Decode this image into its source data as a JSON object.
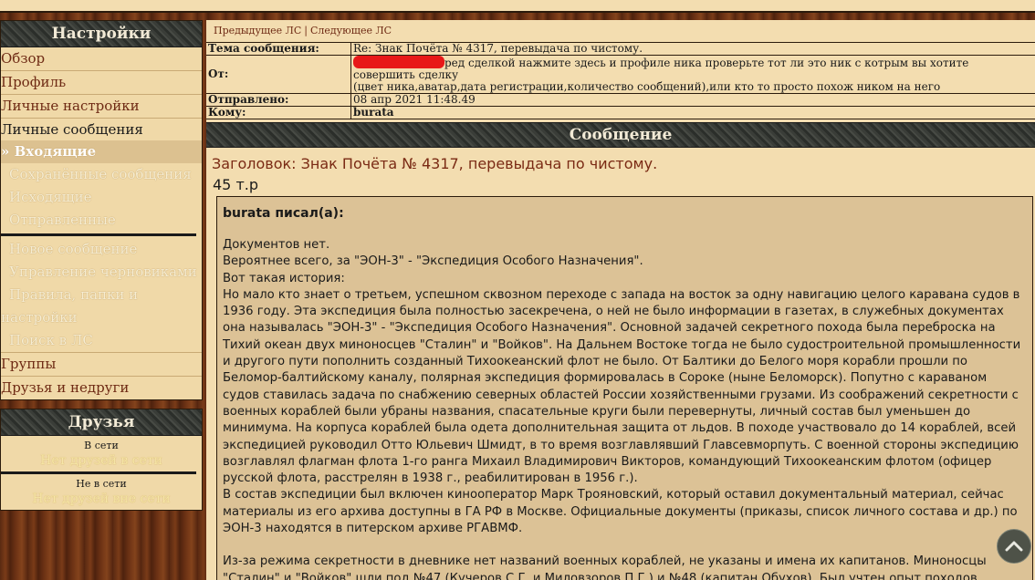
{
  "sidebar": {
    "settings_title": "Настройки",
    "top_items": [
      "Обзор",
      "Профиль",
      "Личные настройки"
    ],
    "pm_title": "Личные сообщения",
    "pm_items": [
      {
        "label": "» Входящие"
      },
      {
        "label": "Сохранённые сообщения"
      },
      {
        "label": "Исходящие"
      },
      {
        "label": "Отправленные"
      }
    ],
    "pm_items2": [
      {
        "label": "Новое сообщение"
      },
      {
        "label": "Управление черновиками"
      },
      {
        "label": "Правила, папки и"
      },
      {
        "label": "настройки"
      },
      {
        "label": "Поиск в ЛС"
      }
    ],
    "bottom_items": [
      "Группы",
      "Друзья и недруги"
    ],
    "friends_title": "Друзья",
    "online_label": "В сети",
    "online_empty": "Нет друзей в сети",
    "offline_label": "Не в сети",
    "offline_empty": "Нет друзей вне сети"
  },
  "nav": {
    "prev": "Предыдущее ЛС",
    "sep": "|",
    "next": "Следующее ЛС"
  },
  "message": {
    "topic_label": "Тема сообщения:",
    "topic_value": "Re: Знак Почёта № 4317, перевыдача по чистому.",
    "from_label": "От:",
    "from_value_line1": "ред сделкой нажмите здесь и профиле ника проверьте тот ли это ник с котрым вы хотите совершить сделку",
    "from_value_line2": "(цвет ника,аватар,дата регистрации,количество сообщений),или кто то просто похож ником на него",
    "sent_label": "Отправлено:",
    "sent_value": "08 апр 2021 11:48.49",
    "to_label": "Кому:",
    "to_value": "burata",
    "section_title": "Сообщение",
    "subject": "Заголовок: Знак Почёта № 4317, перевыдача по чистому.",
    "price": "45 т.р",
    "quote_author": "burata писал(а):",
    "quote_lines": [
      "Документов нет.",
      "Вероятнее всего, за \"ЭОН-3\" - \"Экспедиция Особого Назначения\".",
      "Вот такая история:",
      "Но мало кто знает о третьем, успешном сквозном переходе с запада на восток за одну навигацию целого каравана судов в 1936 году. Эта экспедиция была полностью засекречена, о ней не было информации в газетах, в служебных документах она называлась \"ЭОН-3\" - \"Экспедиция Особого Назначения\". Основной задачей секретного похода была переброска на Тихий океан двух миноносцев \"Сталин\" и \"Войков\". На Дальнем Востоке тогда не было судостроительной промышленности и другого пути пополнить созданный Тихоокеанский флот не было. От Балтики до Белого моря корабли прошли по Беломор-балтийскому каналу, полярная экспедиция формировалась в Сороке (ныне Беломорск). Попутно с караваном судов ставилась задача по снабжению северных областей России хозяйственными грузами. Из соображений секретности с военных кораблей были убраны названия, спасательные круги были перевернуты, личный состав был уменьшен до минимума. На корпуса кораблей была одета дополнительная защита от льдов. В походе участвовало до 14 кораблей, всей экспедицией руководил Отто Юльевич Шмидт, в то время возглавлявший Главсевморпуть. С военной стороны экспедицию возглавлял флагман флота 1-го ранга Михаил Владимирович Викторов, командующий Тихоокеанским флотом (офицер русской флота, расстрелян в 1938 г., реабилитирован в 1956 г.).",
      "В состав экспедиции был включен кинооператор Марк Трояновский, который оставил документальный материал, сейчас материалы из его архива доступны в ГА РФ в Москве. Официальные документы (приказы, список личного состава и др.) по ЭОН-3 находятся в питерском архиве РГАВМФ."
    ],
    "quote_after": "Из-за режима секретности в дневнике нет названий военных кораблей, не указаны и имена их капитанов. Миноносцы \"Сталин\" и \"Войков\" шли под №47 (Кучеров С.Г. и Миловзоров П.Г.) и №48 (капитан Обухов). Был учтен опыт походов"
  },
  "scroll_top_icon": "chevron-up-icon"
}
